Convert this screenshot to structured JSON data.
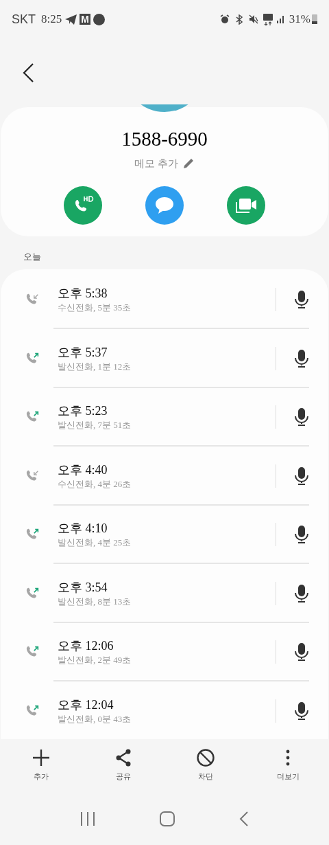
{
  "status_bar": {
    "carrier": "SKT",
    "time": "8:25",
    "mail_badge": "M",
    "battery": "31%"
  },
  "contact": {
    "number": "1588-6990",
    "memo_label": "메모 추가"
  },
  "section_label": "오늘",
  "calls": [
    {
      "kind": "incoming",
      "time": "오후 5:38",
      "detail": "수신전화, 5분 35초"
    },
    {
      "kind": "outgoing",
      "time": "오후 5:37",
      "detail": "발신전화, 1분 12초"
    },
    {
      "kind": "outgoing",
      "time": "오후 5:23",
      "detail": "발신전화, 7분 51초"
    },
    {
      "kind": "incoming",
      "time": "오후 4:40",
      "detail": "수신전화, 4분 26초"
    },
    {
      "kind": "outgoing",
      "time": "오후 4:10",
      "detail": "발신전화, 4분 25초"
    },
    {
      "kind": "outgoing",
      "time": "오후 3:54",
      "detail": "발신전화, 8분 13초"
    },
    {
      "kind": "outgoing",
      "time": "오후 12:06",
      "detail": "발신전화, 2분 49초"
    },
    {
      "kind": "outgoing",
      "time": "오후 12:04",
      "detail": "발신전화, 0분 43초"
    }
  ],
  "toolbar": [
    {
      "kind": "add",
      "label": "추가"
    },
    {
      "kind": "share",
      "label": "공유"
    },
    {
      "kind": "block",
      "label": "차단"
    },
    {
      "kind": "more",
      "label": "더보기"
    }
  ]
}
